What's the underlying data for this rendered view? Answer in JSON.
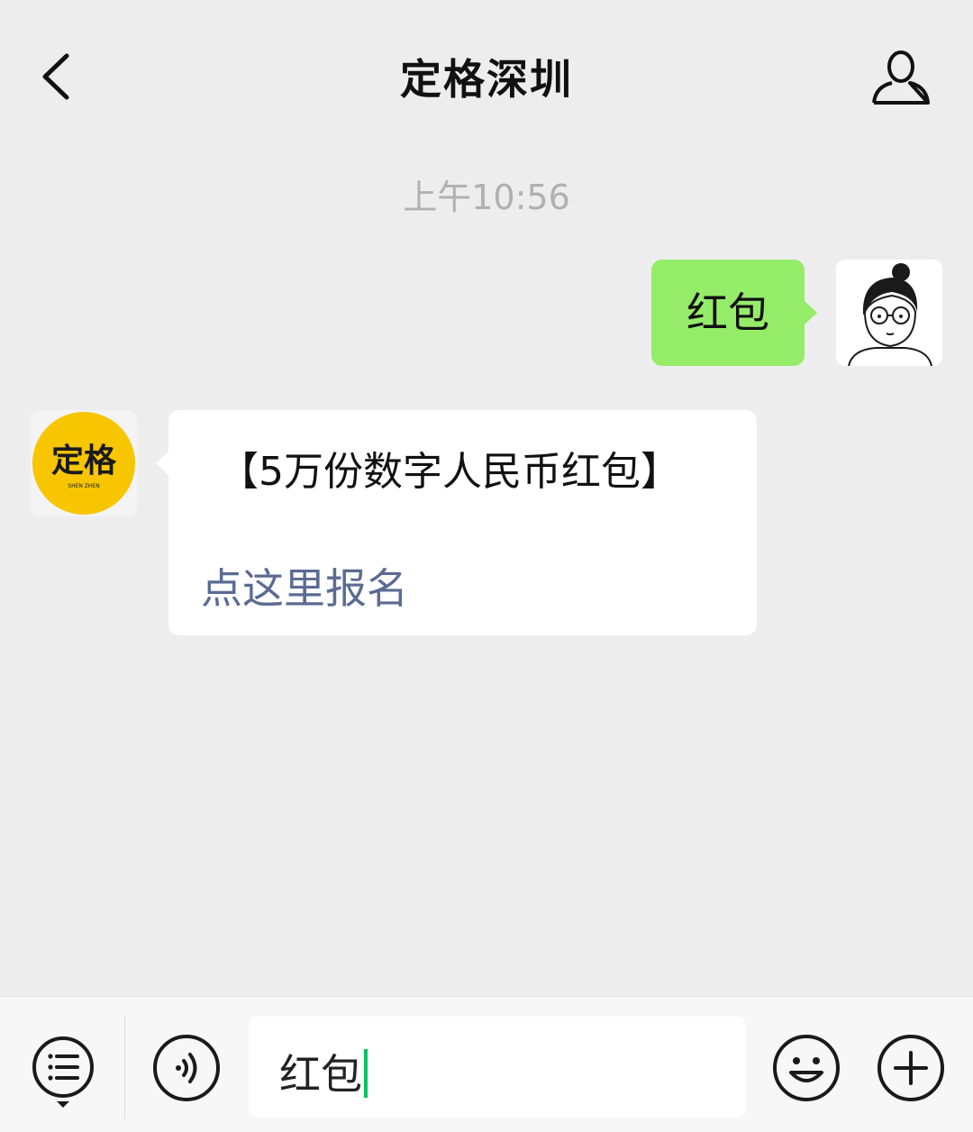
{
  "header": {
    "title": "定格深圳",
    "back_icon": "back-arrow-icon",
    "profile_icon": "person-icon"
  },
  "chat": {
    "timestamp": "上午10:56",
    "messages": [
      {
        "sender": "me",
        "text": "红包"
      },
      {
        "sender": "account",
        "text": "【5万份数字人民币红包】",
        "link": "点这里报名"
      }
    ],
    "account_avatar": {
      "logo_text": "定格",
      "logo_subtext": "SHEN ZHEN",
      "color": "#f7c600"
    }
  },
  "input_bar": {
    "menu_icon": "list-menu-icon",
    "voice_icon": "voice-icon",
    "input_value": "红包",
    "emoji_icon": "emoji-icon",
    "plus_icon": "plus-icon"
  },
  "colors": {
    "background": "#ededed",
    "my_bubble": "#95ec69",
    "link": "#5b6b93",
    "caret": "#07c160"
  }
}
